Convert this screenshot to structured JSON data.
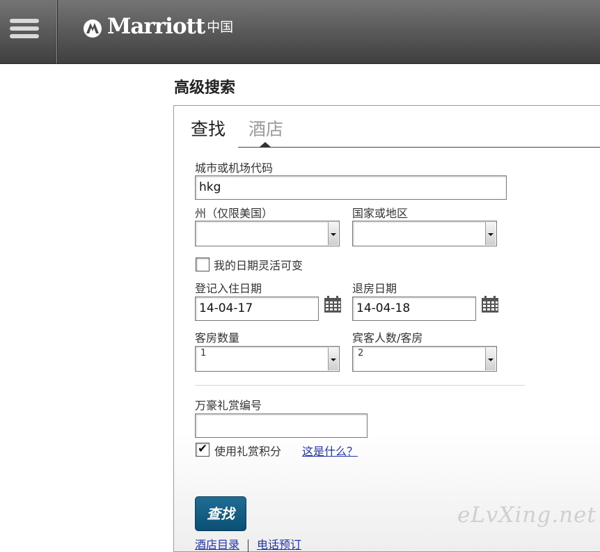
{
  "header": {
    "brand": "Marriott",
    "brand_suffix": "中国",
    "bg_color": "#4a4a4a"
  },
  "page": {
    "title": "高级搜索"
  },
  "tabs": {
    "find": "查找",
    "hotel": "酒店"
  },
  "form": {
    "city_label": "城市或机场代码",
    "city_value": "hkg",
    "state_label": "州（仅限美国）",
    "state_value": "",
    "country_label": "国家或地区",
    "country_value": "",
    "flexible_label": "我的日期灵活可变",
    "flexible_checked": false,
    "checkin_label": "登记入住日期",
    "checkin_value": "14-04-17",
    "checkout_label": "退房日期",
    "checkout_value": "14-04-18",
    "rooms_label": "客房数量",
    "rooms_value": "1",
    "guests_label": "宾客人数/客房",
    "guests_value": "2",
    "rewards_label": "万豪礼赏编号",
    "rewards_value": "",
    "use_points_label": "使用礼赏积分",
    "use_points_checked": true,
    "what_is_this": "这是什么？",
    "submit": "查找"
  },
  "bottom_links": {
    "directory": "酒店目录",
    "phone": "电话预订"
  },
  "icons": {
    "menu": "hamburger-icon",
    "calendar": "calendar-icon",
    "logo": "marriott-logo-icon"
  },
  "colors": {
    "button": "#0b4f73",
    "link": "#2233aa"
  },
  "watermark": "eLvXing.net"
}
